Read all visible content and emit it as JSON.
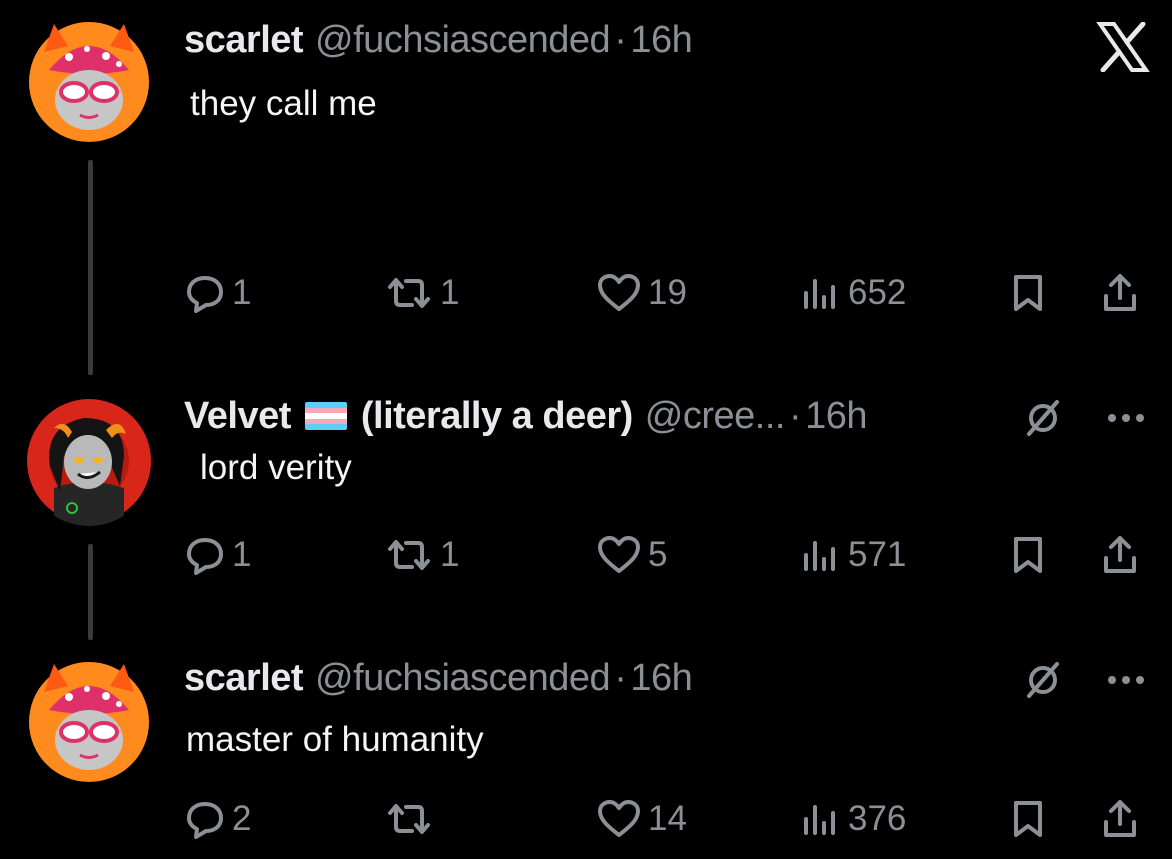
{
  "brand": {
    "logo_icon": "x-logo-icon",
    "text_color": "#e7e9ea",
    "muted_color": "#8b9096",
    "background": "#000000"
  },
  "tweets": [
    {
      "author_name": "scarlet",
      "handle": "@fuchsiascended",
      "separator": "·",
      "time": "16h",
      "text": "they call me",
      "avatar": "avatar-scarlet",
      "replies": "1",
      "reposts": "1",
      "likes": "19",
      "views": "652"
    },
    {
      "author_name": "Velvet",
      "flag": "transgender-flag",
      "author_suffix": "(literally a deer)",
      "handle": "@cree...",
      "separator": "·",
      "time": "16h",
      "text": "lord verity",
      "avatar": "avatar-velvet",
      "hidden_reply_icon": "hidden-reply-icon",
      "more_icon": "more-icon",
      "replies": "1",
      "reposts": "1",
      "likes": "5",
      "views": "571"
    },
    {
      "author_name": "scarlet",
      "handle": "@fuchsiascended",
      "separator": "·",
      "time": "16h",
      "text": "master of humanity",
      "avatar": "avatar-scarlet",
      "hidden_reply_icon": "hidden-reply-icon",
      "more_icon": "more-icon",
      "replies": "2",
      "reposts": "",
      "likes": "14",
      "views": "376"
    }
  ]
}
